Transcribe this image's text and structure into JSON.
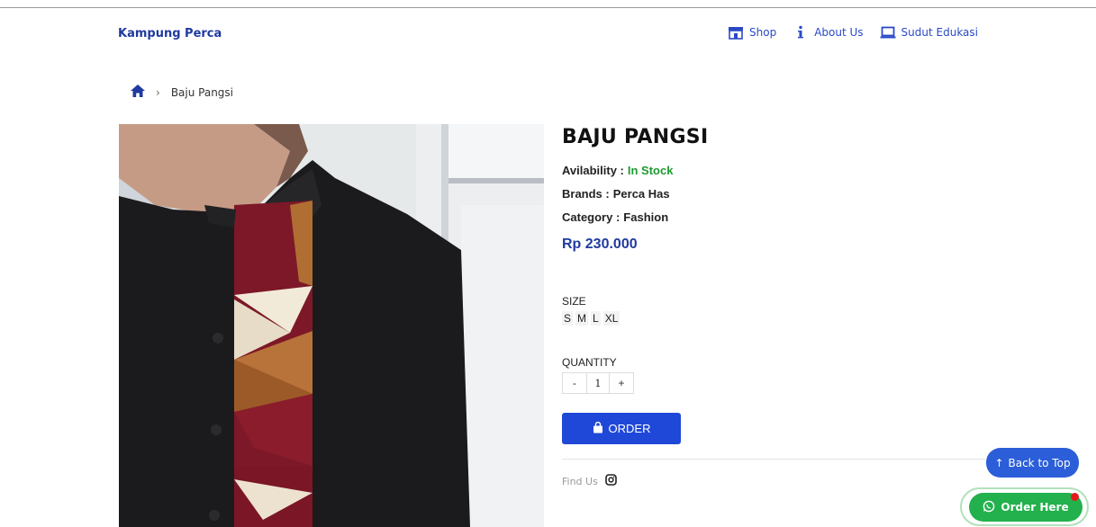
{
  "header": {
    "brand": "Kampung Perca",
    "nav": [
      {
        "label": "Shop",
        "icon": "store-icon"
      },
      {
        "label": "About Us",
        "icon": "info-icon"
      },
      {
        "label": "Sudut Edukasi",
        "icon": "laptop-icon"
      }
    ]
  },
  "breadcrumb": {
    "home_icon": "home-icon",
    "current": "Baju Pangsi"
  },
  "product": {
    "title": "BAJU PANGSI",
    "availability_label": "Avilability :",
    "availability_value": "In Stock",
    "brands_label": "Brands :",
    "brands_value": "Perca Has",
    "category_label": "Category :",
    "category_value": "Fashion",
    "price": "Rp 230.000",
    "size_label": "SIZE",
    "sizes": [
      "S",
      "M",
      "L",
      "XL"
    ],
    "quantity_label": "QUANTITY",
    "quantity_minus": "-",
    "quantity_value": "1",
    "quantity_plus": "+",
    "order_label": "ORDER",
    "find_us_label": "Find Us"
  },
  "floating": {
    "back_to_top": "Back to Top",
    "order_here": "Order Here"
  },
  "colors": {
    "brand_blue": "#1f3aa0",
    "button_blue": "#1f48d8",
    "stock_green": "#1e9a2e",
    "whatsapp_green": "#22b14c"
  }
}
